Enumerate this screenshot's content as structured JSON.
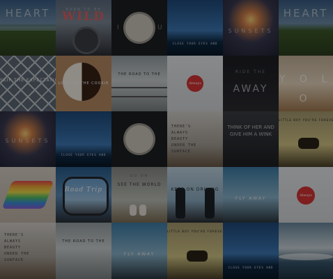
{
  "tiles": [
    {
      "text": "HEART",
      "sub": ""
    },
    {
      "text": "WILD",
      "sub": "BORN TO BE"
    },
    {
      "text": "I ◯ U",
      "sub": ""
    },
    {
      "text": "",
      "sub": "CLOSE YOUR EYES AND"
    },
    {
      "text": "SUNSETS",
      "sub": ""
    },
    {
      "text": "HEART",
      "sub": ""
    },
    {
      "text": "SKIP THE EXPECTATIONS",
      "sub": ""
    },
    {
      "text": "LOOK TO THE COOKIE",
      "sub": ""
    },
    {
      "text": "THE ROAD TO THE",
      "sub": ""
    },
    {
      "text": "Always",
      "sub": ""
    },
    {
      "text": "AWAY",
      "sub": "RIDE THE"
    },
    {
      "text": "Y O L O",
      "sub": ""
    },
    {
      "text": "SUNSETS",
      "sub": ""
    },
    {
      "text": "",
      "sub": "CLOSE YOUR EYES AND"
    },
    {
      "text": "I ◯ U",
      "sub": ""
    },
    {
      "text": "THERE'S ALWAYS BEAUTY UNDER THE SURFACE",
      "sub": ""
    },
    {
      "text": "THINK OF HER AND GIVE HIM A WINK",
      "sub": ""
    },
    {
      "text": "LITTLE BOY YOU'RE FOREVER",
      "sub": ""
    },
    {
      "text": "",
      "sub": ""
    },
    {
      "text": "Road Trip",
      "sub": ""
    },
    {
      "text": "SEE THE WORLD",
      "sub": "GO ON"
    },
    {
      "text": "KEEP ON DRIVING",
      "sub": ""
    },
    {
      "text": "FLY AWAY",
      "sub": ""
    },
    {
      "text": "Always",
      "sub": ""
    },
    {
      "text": "THERE'S ALWAYS BEAUTY UNDER THE SURFACE",
      "sub": ""
    },
    {
      "text": "THE ROAD TO THE",
      "sub": ""
    },
    {
      "text": "FLY AWAY",
      "sub": ""
    },
    {
      "text": "LITTLE BOY YOU'RE FOREVER",
      "sub": ""
    },
    {
      "text": "",
      "sub": "CLOSE YOUR EYES AND"
    },
    {
      "text": "",
      "sub": ""
    }
  ]
}
